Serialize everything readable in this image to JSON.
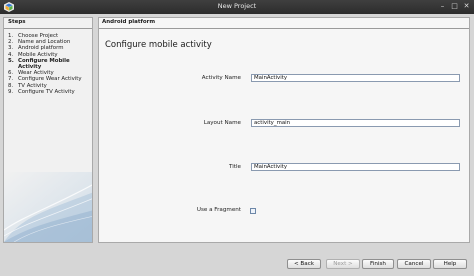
{
  "window": {
    "title": "New Project",
    "controls": [
      "–",
      "□",
      "✕"
    ]
  },
  "steps": {
    "header": "Steps",
    "items": [
      {
        "num": "1.",
        "label": "Choose Project",
        "active": false
      },
      {
        "num": "2.",
        "label": "Name and Location",
        "active": false
      },
      {
        "num": "3.",
        "label": "Android platform",
        "active": false
      },
      {
        "num": "4.",
        "label": "Mobile Activity",
        "active": false
      },
      {
        "num": "5.",
        "label": "Configure Mobile Activity",
        "active": true
      },
      {
        "num": "6.",
        "label": "Wear Activity",
        "active": false
      },
      {
        "num": "7.",
        "label": "Configure Wear Activity",
        "active": false
      },
      {
        "num": "8.",
        "label": "TV Activity",
        "active": false
      },
      {
        "num": "9.",
        "label": "Configure TV Activity",
        "active": false
      }
    ]
  },
  "content": {
    "header": "Android platform",
    "title": "Configure mobile activity",
    "fields": {
      "activity_name": {
        "label": "Activity Name",
        "value": "MainActivity"
      },
      "layout_name": {
        "label": "Layout Name",
        "value": "activity_main"
      },
      "title": {
        "label": "Title",
        "value": "MainActivity"
      },
      "use_fragment": {
        "label": "Use a Fragment",
        "checked": false
      }
    }
  },
  "buttons": {
    "back": "< Back",
    "next": "Next >",
    "finish": "Finish",
    "cancel": "Cancel",
    "help": "Help"
  }
}
